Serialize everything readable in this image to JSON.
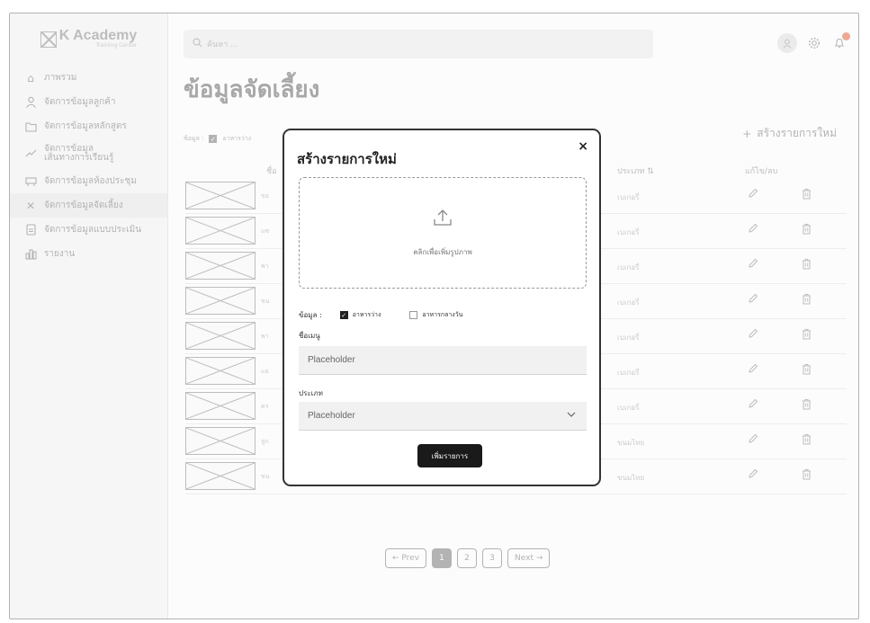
{
  "app": {
    "logo_title": "K Academy",
    "logo_subtitle": "Training Center"
  },
  "sidebar": {
    "items": [
      {
        "label": "ภาพรวม",
        "icon": "home-icon"
      },
      {
        "label": "จัดการข้อมูลลูกค้า",
        "icon": "user-icon"
      },
      {
        "label": "จัดการข้อมูลหลักสูตร",
        "icon": "folder-icon"
      },
      {
        "label_line1": "จัดการข้อมูล",
        "label_line2": "เส้นทางการเรียนรู้",
        "icon": "trend-icon"
      },
      {
        "label": "จัดการข้อมูลห้องประชุม",
        "icon": "meeting-room-icon"
      },
      {
        "label": "จัดการข้อมูลจัดเลี้ยง",
        "icon": "utensils-icon",
        "active": true
      },
      {
        "label": "จัดการข้อมูลแบบประเมิน",
        "icon": "document-icon"
      },
      {
        "label": "รายงาน",
        "icon": "chart-icon"
      }
    ]
  },
  "header": {
    "search_placeholder": "ค้นหา ..."
  },
  "page": {
    "title": "ข้อมูลจัดเลี้ยง",
    "filter_label": "ข้อมูล :",
    "filter_option1": "อาหารว่าง",
    "add_new_label": "สร้างรายการใหม่",
    "col_name": "ชื่อ",
    "col_type": "ประเภท",
    "col_actions": "แก้ไข/ลบ"
  },
  "rows": [
    {
      "name": "ขอ",
      "type": "เบเกอรี่"
    },
    {
      "name": "แซ",
      "type": "เบเกอรี่"
    },
    {
      "name": "พา",
      "type": "เบเกอรี่"
    },
    {
      "name": "ขน",
      "type": "เบเกอรี่"
    },
    {
      "name": "พา",
      "type": "เบเกอรี่"
    },
    {
      "name": "แย",
      "type": "เบเกอรี่"
    },
    {
      "name": "คร",
      "type": "เบเกอรี่"
    },
    {
      "name": "ลูก",
      "type": "ขนมไทย"
    },
    {
      "name": "ขน",
      "type": "ขนมไทย"
    }
  ],
  "pagination": {
    "prev": "← Prev",
    "pages": [
      "1",
      "2",
      "3"
    ],
    "current": "1",
    "next": "Next →"
  },
  "modal": {
    "title": "สร้างรายการใหม่",
    "close": "×",
    "upload_text": "คลิกเพื่อเพิ่มรูปภาพ",
    "filter_label": "ข้อมูล :",
    "option1": "อาหารว่าง",
    "option1_checked": true,
    "option2": "อาหารกลางวัน",
    "option2_checked": false,
    "name_label": "ชื่อเมนู",
    "name_placeholder": "Placeholder",
    "type_label": "ประเภท",
    "type_placeholder": "Placeholder",
    "submit_label": "เพิ่มรายการ"
  }
}
